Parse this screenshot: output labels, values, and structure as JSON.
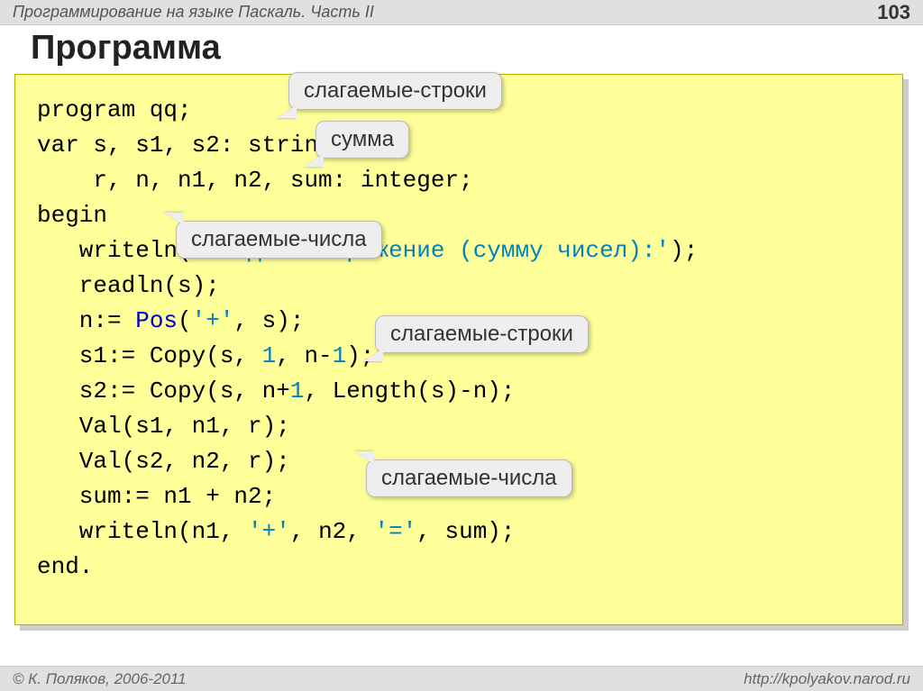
{
  "header": {
    "title": "Программирование на языке Паскаль. Часть II",
    "page_number": "103"
  },
  "title": "Программа",
  "code": {
    "l1": "program qq;",
    "l2": "var s, s1, s2: string;",
    "l3": "    r, n, n1, n2, sum: integer;",
    "l4": "begin",
    "l5a": "   writeln(",
    "l5b": "'Введите выражение (сумму чисел):'",
    "l5c": ");",
    "l6": "   readln(s);",
    "l7a": "   n:= ",
    "l7b": "Pos",
    "l7c": "(",
    "l7d": "'+'",
    "l7e": ", s);",
    "l8a": "   s1:= Copy(s, ",
    "l8b": "1",
    "l8c": ", n-",
    "l8d": "1",
    "l8e": ");",
    "l9a": "   s2:= Copy(s, n+",
    "l9b": "1",
    "l9c": ", Length(s)-n);",
    "l10": "   Val(s1, n1, r);",
    "l11": "   Val(s2, n2, r);",
    "l12": "   sum:= n1 + n2;",
    "l13a": "   writeln(n1, ",
    "l13b": "'+'",
    "l13c": ", n2, ",
    "l13d": "'='",
    "l13e": ", sum);",
    "l14": "end."
  },
  "callouts": {
    "c1": "слагаемые-строки",
    "c2": "сумма",
    "c3": "слагаемые-числа",
    "c4": "слагаемые-строки",
    "c5": "слагаемые-числа"
  },
  "footer": {
    "copyright": "© К. Поляков, 2006-2011",
    "url": "http://kpolyakov.narod.ru"
  }
}
